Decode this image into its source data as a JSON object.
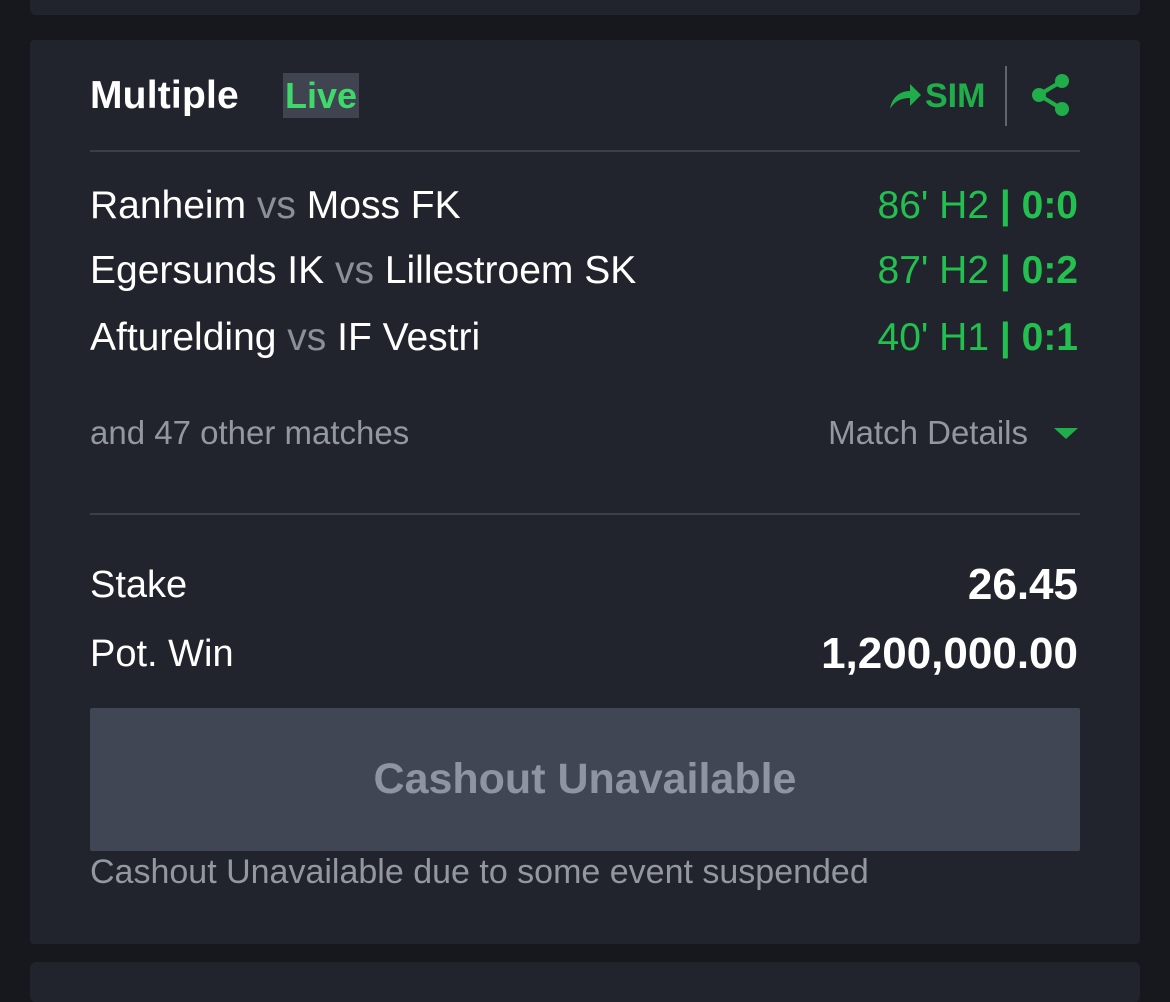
{
  "bet": {
    "title": "Multiple",
    "live_badge": "Live",
    "sim_label": "SIM"
  },
  "matches": [
    {
      "home": "Ranheim",
      "vs": "vs",
      "away": "Moss FK",
      "time": "86' H2",
      "separator": "|",
      "score": "0:0"
    },
    {
      "home": "Egersunds IK",
      "vs": "vs",
      "away": "Lillestroem SK",
      "time": "87' H2",
      "separator": "|",
      "score": "0:2"
    },
    {
      "home": "Afturelding",
      "vs": "vs",
      "away": "IF Vestri",
      "time": "40' H1",
      "separator": "|",
      "score": "0:1"
    }
  ],
  "other_matches": "and 47 other matches",
  "match_details_label": "Match Details",
  "stake": {
    "label": "Stake",
    "value": "26.45"
  },
  "pot_win": {
    "label": "Pot. Win",
    "value": "1,200,000.00"
  },
  "cashout": {
    "button_label": "Cashout Unavailable",
    "note": "Cashout Unavailable due to some event suspended"
  },
  "icons": {
    "sim": "share-arrow-icon",
    "share": "share-network-icon",
    "details": "caret-down-icon"
  },
  "colors": {
    "accent_green": "#1fae4a",
    "live_green": "#3fd96b",
    "card_bg": "#21242c",
    "page_bg": "#16181d",
    "button_bg": "#414654",
    "muted_text": "#9297a1"
  }
}
